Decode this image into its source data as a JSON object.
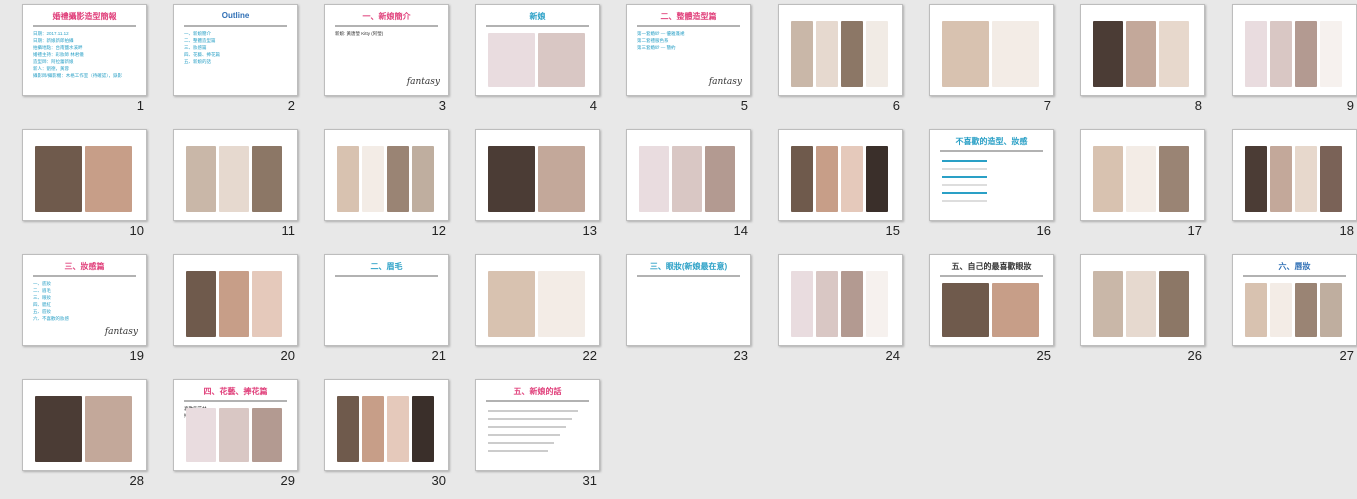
{
  "slides": [
    {
      "n": "1",
      "title": "婚禮攝影造型簡報",
      "title_color": "#e0407b",
      "lines": [
        "日期：2017.11.12",
        "日期：新娘新郎拍攝",
        "拍攝地點：台南鹽水溪畔",
        "婚禮主持：彩妝師 林君儀",
        "造型師：阿拉蕾新娘",
        "新人：劉德，黃蓉",
        "攝影師/攝影機：木格工作室（待確認），錄影"
      ]
    },
    {
      "n": "2",
      "title": "Outline",
      "title_color": "#2f6fb5",
      "lines": [
        "一、新娘簡介",
        "二、整體造型篇",
        "三、妝感篇",
        "四、花藝、捧花篇",
        "五、新娘的話"
      ]
    },
    {
      "n": "3",
      "title": "一、新娘簡介",
      "title_color": "#e0407b",
      "lines": [
        "新娘: 黃唐瑩 Kitty (阿瑩)"
      ]
    },
    {
      "n": "4",
      "title": "新娘",
      "title_color": "#2aa0c6",
      "lines": []
    },
    {
      "n": "5",
      "title": "二、整體造型篇",
      "title_color": "#e0407b",
      "lines": [
        "第一套婚紗 — 優雅蓬裙",
        "第二套禮服色系",
        "第三套婚紗 — 簡約"
      ]
    },
    {
      "n": "6",
      "title": "",
      "lines": []
    },
    {
      "n": "7",
      "title": "",
      "lines": []
    },
    {
      "n": "8",
      "title": "",
      "lines": []
    },
    {
      "n": "9",
      "title": "",
      "lines": []
    },
    {
      "n": "10",
      "title": "",
      "lines": []
    },
    {
      "n": "11",
      "title": "",
      "lines": []
    },
    {
      "n": "12",
      "title": "",
      "lines": []
    },
    {
      "n": "13",
      "title": "",
      "lines": []
    },
    {
      "n": "14",
      "title": "",
      "lines": []
    },
    {
      "n": "15",
      "title": "",
      "lines": []
    },
    {
      "n": "16",
      "title": "不喜歡的造型、妝感",
      "title_color": "#2aa0c6",
      "lines": []
    },
    {
      "n": "17",
      "title": "",
      "lines": []
    },
    {
      "n": "18",
      "title": "",
      "lines": []
    },
    {
      "n": "19",
      "title": "三、妝感篇",
      "title_color": "#e0407b",
      "lines": [
        "一、底妝",
        "二、眉毛",
        "三、眼妝",
        "四、腮紅",
        "五、唇妝",
        "六、不喜歡的妝感"
      ]
    },
    {
      "n": "20",
      "title": "",
      "lines": []
    },
    {
      "n": "21",
      "title": "二、眉毛",
      "title_color": "#2aa0c6",
      "lines": []
    },
    {
      "n": "22",
      "title": "",
      "lines": []
    },
    {
      "n": "23",
      "title": "三、眼妝(新娘最在意)",
      "title_color": "#2aa0c6",
      "lines": []
    },
    {
      "n": "24",
      "title": "",
      "lines": []
    },
    {
      "n": "25",
      "title": "五、自己的最喜歡眼妝",
      "title_color": "#333333",
      "lines": []
    },
    {
      "n": "26",
      "title": "",
      "lines": []
    },
    {
      "n": "27",
      "title": "六、唇妝",
      "title_color": "#2f6fb5",
      "lines": []
    },
    {
      "n": "28",
      "title": "",
      "lines": []
    },
    {
      "n": "29",
      "title": "四、花藝、捧花篇",
      "title_color": "#e0407b",
      "lines": [
        "喜歡的花材",
        "捧花顏色"
      ]
    },
    {
      "n": "30",
      "title": "",
      "lines": []
    },
    {
      "n": "31",
      "title": "五、新娘的話",
      "title_color": "#e0407b",
      "lines": []
    }
  ],
  "logo_text": "fantasy",
  "colors": {
    "background": "#e8e8e8",
    "pink": "#e0407b",
    "blue": "#2aa0c6"
  }
}
